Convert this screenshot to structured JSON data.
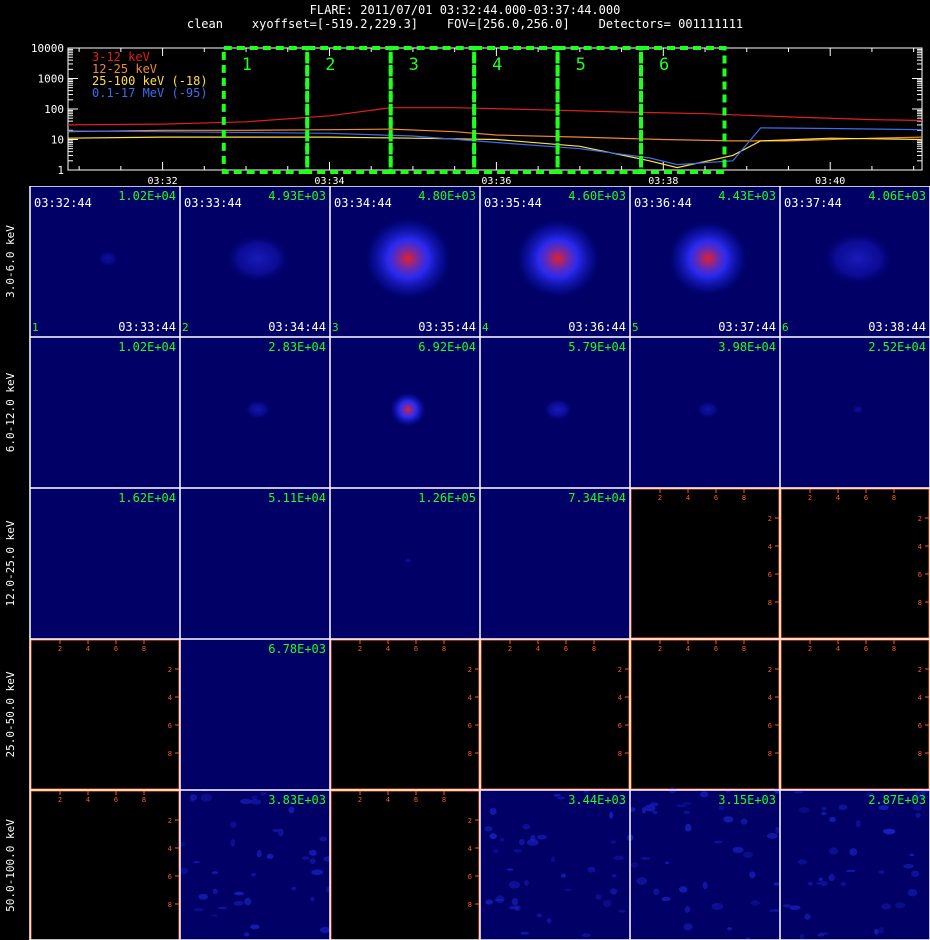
{
  "header": {
    "title": "FLARE: 2011/07/01 03:32:44.000-03:37:44.000",
    "subtitle": "clean    xyoffset=[-519.2,229.3]    FOV=[256.0,256.0]    Detectors= 001111111"
  },
  "chart_data": [
    {
      "type": "line",
      "ylabel": "",
      "xlabel": "",
      "y_scale": "log",
      "ylim": [
        1,
        10000
      ],
      "xlim": [
        "03:30:52",
        "03:41:06"
      ],
      "y_ticks": [
        "10000",
        "1000",
        "100",
        "10",
        "1"
      ],
      "x_ticks": [
        "03:32",
        "03:34",
        "03:36",
        "03:38",
        "03:40"
      ],
      "legend_position": "top-left",
      "series": [
        {
          "name": "3-12 keV",
          "color": "#e0201a",
          "x": [
            "03:30:52",
            "03:32:00",
            "03:33:00",
            "03:34:00",
            "03:34:44",
            "03:35:30",
            "03:36:30",
            "03:37:30",
            "03:38:30",
            "03:39:30",
            "03:40:30",
            "03:41:06"
          ],
          "values": [
            30,
            32,
            38,
            60,
            110,
            110,
            95,
            80,
            70,
            55,
            45,
            42
          ]
        },
        {
          "name": "12-25 keV",
          "color": "#f08a30",
          "x": [
            "03:30:52",
            "03:32:00",
            "03:33:00",
            "03:34:00",
            "03:34:44",
            "03:35:30",
            "03:36:00",
            "03:37:00",
            "03:38:00",
            "03:38:50",
            "03:39:30",
            "03:40:30",
            "03:41:06"
          ],
          "values": [
            18,
            20,
            20,
            21,
            22,
            18,
            14,
            12,
            10,
            9,
            9,
            11,
            12
          ]
        },
        {
          "name": "25-100 keV (-18)",
          "color": "#ffe040",
          "x": [
            "03:30:52",
            "03:32:00",
            "03:33:00",
            "03:34:00",
            "03:35:00",
            "03:36:00",
            "03:37:00",
            "03:37:50",
            "03:38:10",
            "03:38:50",
            "03:39:10",
            "03:40:00",
            "03:41:06"
          ],
          "values": [
            11,
            12,
            12,
            12,
            11,
            10,
            6,
            2,
            1.2,
            3,
            9,
            11,
            10
          ]
        },
        {
          "name": "0.1-17 MeV (-95)",
          "color": "#3a6ef0",
          "x": [
            "03:30:52",
            "03:32:00",
            "03:33:00",
            "03:34:00",
            "03:35:00",
            "03:36:00",
            "03:37:00",
            "03:37:50",
            "03:38:10",
            "03:38:50",
            "03:39:10",
            "03:40:00",
            "03:41:06"
          ],
          "values": [
            19,
            18,
            17,
            16,
            13,
            8,
            5,
            2.5,
            1.5,
            2,
            24,
            23,
            21
          ]
        }
      ],
      "intervals": [
        {
          "label": "1",
          "start": "03:32:44",
          "end": "03:33:44"
        },
        {
          "label": "2",
          "start": "03:33:44",
          "end": "03:34:44"
        },
        {
          "label": "3",
          "start": "03:34:44",
          "end": "03:35:44"
        },
        {
          "label": "4",
          "start": "03:35:44",
          "end": "03:36:44"
        },
        {
          "label": "5",
          "start": "03:36:44",
          "end": "03:37:44"
        },
        {
          "label": "6",
          "start": "03:37:44",
          "end": "03:38:44"
        }
      ],
      "interval_color": "#20ff20"
    },
    {
      "type": "heatmap",
      "row_labels": [
        "3.0-6.0 keV",
        "6.0-12.0 keV",
        "12.0-25.0 keV",
        "25.0-50.0 keV",
        "50.0-100.0 keV"
      ],
      "col_start_times": [
        "03:32:44",
        "03:33:44",
        "03:34:44",
        "03:35:44",
        "03:36:44",
        "03:37:44"
      ],
      "col_end_times": [
        "03:33:44",
        "03:34:44",
        "03:35:44",
        "03:36:44",
        "03:37:44",
        "03:38:44"
      ],
      "col_numbers": [
        "1",
        "2",
        "3",
        "4",
        "5",
        "6"
      ],
      "empty_axis_ticks": [
        "2",
        "4",
        "6",
        "8"
      ],
      "empty_axis_color": "#ff5a1a",
      "max_label_color": "#20ff20",
      "rows": [
        [
          {
            "max": "1.02E+04",
            "intensity": 0.15,
            "size": 0.15
          },
          {
            "max": "4.93E+03",
            "intensity": 0.55,
            "size": 0.45
          },
          {
            "max": "4.80E+03",
            "intensity": 1.0,
            "size": 0.6
          },
          {
            "max": "4.60E+03",
            "intensity": 0.9,
            "size": 0.58
          },
          {
            "max": "4.43E+03",
            "intensity": 0.85,
            "size": 0.55
          },
          {
            "max": "4.06E+03",
            "intensity": 0.55,
            "size": 0.5
          }
        ],
        [
          {
            "max": "1.02E+04",
            "intensity": 0.0,
            "size": 0.0
          },
          {
            "max": "2.83E+04",
            "intensity": 0.45,
            "size": 0.18
          },
          {
            "max": "6.92E+04",
            "intensity": 0.7,
            "size": 0.25
          },
          {
            "max": "5.79E+04",
            "intensity": 0.55,
            "size": 0.2
          },
          {
            "max": "3.98E+04",
            "intensity": 0.4,
            "size": 0.16
          },
          {
            "max": "2.52E+04",
            "intensity": 0.15,
            "size": 0.08
          }
        ],
        [
          {
            "max": "1.62E+04",
            "intensity": 0.0,
            "size": 0.0
          },
          {
            "max": "5.11E+04",
            "intensity": 0.0,
            "size": 0.0
          },
          {
            "max": "1.26E+05",
            "intensity": 0.1,
            "size": 0.05
          },
          {
            "max": "7.34E+04",
            "intensity": 0.0,
            "size": 0.0
          },
          null,
          null
        ],
        [
          null,
          {
            "max": "6.78E+03",
            "intensity": 0.0,
            "size": 0.0
          },
          null,
          null,
          null,
          null
        ],
        [
          null,
          {
            "max": "3.83E+03",
            "intensity": 0.2,
            "size": 0.0
          },
          null,
          {
            "max": "3.44E+03",
            "intensity": 0.2,
            "size": 0.0
          },
          {
            "max": "3.15E+03",
            "intensity": 0.2,
            "size": 0.0
          },
          {
            "max": "2.87E+03",
            "intensity": 0.2,
            "size": 0.0
          }
        ]
      ]
    }
  ]
}
